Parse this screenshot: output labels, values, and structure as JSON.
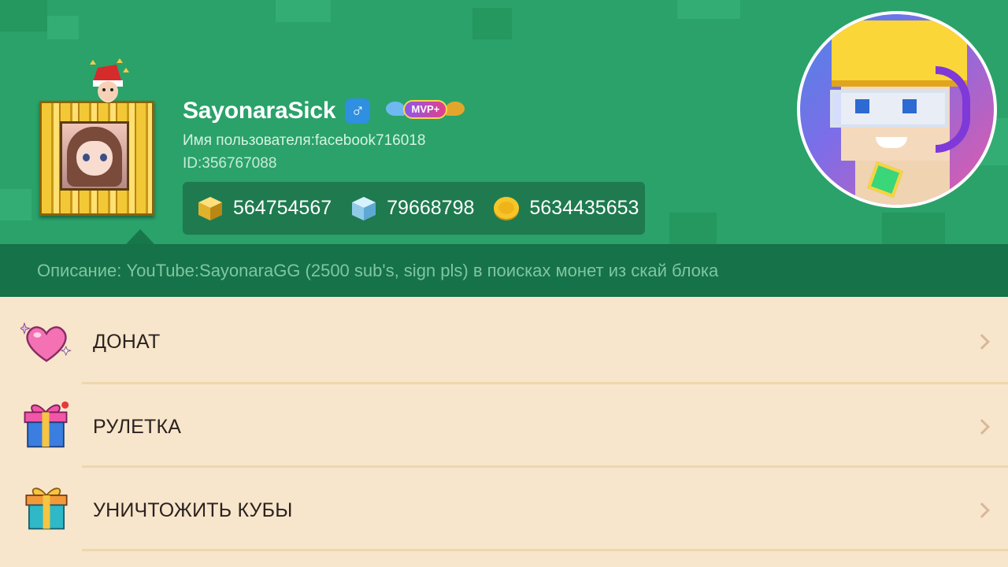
{
  "profile": {
    "username": "SayonaraSick",
    "gender_symbol": "♂",
    "badge": "MVP+",
    "login_line": "Имя пользователя:facebook716018",
    "id_line": "ID:356767088"
  },
  "currencies": [
    {
      "icon": "gold-cube-icon",
      "value": "564754567"
    },
    {
      "icon": "diamond-cube-icon",
      "value": "79668798"
    },
    {
      "icon": "gold-coin-icon",
      "value": "5634435653"
    }
  ],
  "description": "Описание: YouTube:SayonaraGG (2500 sub's, sign pls) в поисках монет из скай блока",
  "menu": {
    "items": [
      {
        "label": "ДОНАТ",
        "icon": "heart-icon"
      },
      {
        "label": "РУЛЕТКА",
        "icon": "gift-box-icon"
      },
      {
        "label": "УНИЧТОЖИТЬ КУБЫ",
        "icon": "gift-box-icon"
      }
    ]
  },
  "colors": {
    "header_green": "#2aa26a",
    "description_bar": "#167248",
    "menu_background": "#f7e6cb"
  }
}
